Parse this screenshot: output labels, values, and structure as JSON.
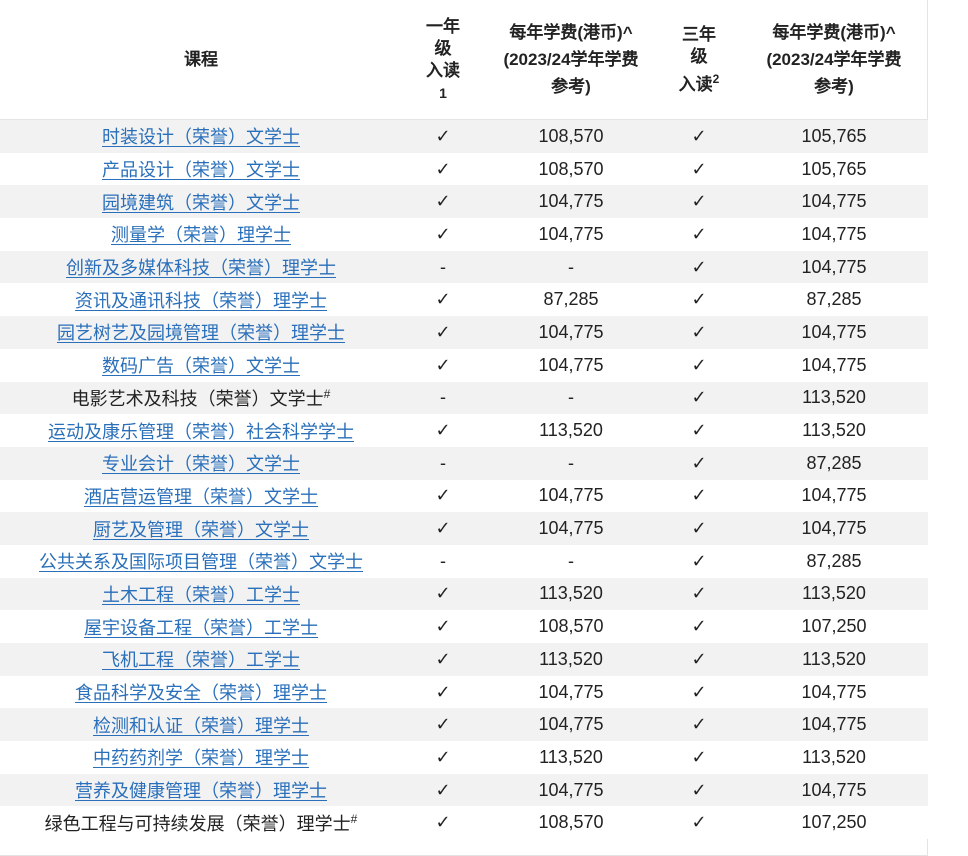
{
  "header": {
    "course": "课程",
    "year1_lines": [
      "一年",
      "级",
      "入读",
      "1"
    ],
    "fee1_lines": [
      "每年学费(港币)^",
      "(2023/24学年学费",
      "参考)"
    ],
    "year3_lines": [
      "三年",
      "级",
      "入读",
      "2"
    ],
    "fee2_lines": [
      "每年学费(港币)^",
      "(2023/24学年学费",
      "参考)"
    ]
  },
  "rows": [
    {
      "course": "时装设计（荣誉）文学士",
      "link": true,
      "sup": "",
      "y1": "✓",
      "fee1": "108,570",
      "y3": "✓",
      "fee2": "105,765"
    },
    {
      "course": "产品设计（荣誉）文学士",
      "link": true,
      "sup": "",
      "y1": "✓",
      "fee1": "108,570",
      "y3": "✓",
      "fee2": "105,765"
    },
    {
      "course": "园境建筑（荣誉）文学士",
      "link": true,
      "sup": "",
      "y1": "✓",
      "fee1": "104,775",
      "y3": "✓",
      "fee2": "104,775"
    },
    {
      "course": "测量学（荣誉）理学士",
      "link": true,
      "sup": "",
      "y1": "✓",
      "fee1": "104,775",
      "y3": "✓",
      "fee2": "104,775"
    },
    {
      "course": "创新及多媒体科技（荣誉）理学士",
      "link": true,
      "sup": "",
      "y1": "-",
      "fee1": "-",
      "y3": "✓",
      "fee2": "104,775"
    },
    {
      "course": "资讯及通讯科技（荣誉）理学士",
      "link": true,
      "sup": "",
      "y1": "✓",
      "fee1": "87,285",
      "y3": "✓",
      "fee2": "87,285"
    },
    {
      "course": "园艺树艺及园境管理（荣誉）理学士",
      "link": true,
      "sup": "",
      "y1": "✓",
      "fee1": "104,775",
      "y3": "✓",
      "fee2": "104,775"
    },
    {
      "course": "数码广告（荣誉）文学士",
      "link": true,
      "sup": "",
      "y1": "✓",
      "fee1": "104,775",
      "y3": "✓",
      "fee2": "104,775"
    },
    {
      "course": "电影艺术及科技（荣誉）文学士",
      "link": false,
      "sup": "#",
      "y1": "-",
      "fee1": "-",
      "y3": "✓",
      "fee2": "113,520"
    },
    {
      "course": "运动及康乐管理（荣誉）社会科学学士",
      "link": true,
      "sup": "",
      "y1": "✓",
      "fee1": "113,520",
      "y3": "✓",
      "fee2": "113,520"
    },
    {
      "course": "专业会计（荣誉）文学士",
      "link": true,
      "sup": "",
      "y1": "-",
      "fee1": "-",
      "y3": "✓",
      "fee2": "87,285"
    },
    {
      "course": "酒店营运管理（荣誉）文学士",
      "link": true,
      "sup": "",
      "y1": "✓",
      "fee1": "104,775",
      "y3": "✓",
      "fee2": "104,775"
    },
    {
      "course": "厨艺及管理（荣誉）文学士",
      "link": true,
      "sup": "",
      "y1": "✓",
      "fee1": "104,775",
      "y3": "✓",
      "fee2": "104,775"
    },
    {
      "course": "公共关系及国际项目管理（荣誉）文学士",
      "link": true,
      "sup": "",
      "y1": "-",
      "fee1": "-",
      "y3": "✓",
      "fee2": "87,285"
    },
    {
      "course": "土木工程（荣誉）工学士",
      "link": true,
      "sup": "",
      "y1": "✓",
      "fee1": "113,520",
      "y3": "✓",
      "fee2": "113,520"
    },
    {
      "course": "屋宇设备工程（荣誉）工学士",
      "link": true,
      "sup": "",
      "y1": "✓",
      "fee1": "108,570",
      "y3": "✓",
      "fee2": "107,250"
    },
    {
      "course": "飞机工程（荣誉）工学士",
      "link": true,
      "sup": "",
      "y1": "✓",
      "fee1": "113,520",
      "y3": "✓",
      "fee2": "113,520"
    },
    {
      "course": "食品科学及安全（荣誉）理学士",
      "link": true,
      "sup": "",
      "y1": "✓",
      "fee1": "104,775",
      "y3": "✓",
      "fee2": "104,775"
    },
    {
      "course": "检测和认证（荣誉）理学士",
      "link": true,
      "sup": "",
      "y1": "✓",
      "fee1": "104,775",
      "y3": "✓",
      "fee2": "104,775"
    },
    {
      "course": "中药药剂学（荣誉）理学士",
      "link": true,
      "sup": "",
      "y1": "✓",
      "fee1": "113,520",
      "y3": "✓",
      "fee2": "113,520"
    },
    {
      "course": "营养及健康管理（荣誉）理学士",
      "link": true,
      "sup": "",
      "y1": "✓",
      "fee1": "104,775",
      "y3": "✓",
      "fee2": "104,775"
    },
    {
      "course": "绿色工程与可持续发展（荣誉）理学士",
      "link": false,
      "sup": "#",
      "y1": "✓",
      "fee1": "108,570",
      "y3": "✓",
      "fee2": "107,250"
    }
  ],
  "colors": {
    "link": "#2a6fba",
    "stripe": "#f2f2f2",
    "text": "#222222"
  }
}
